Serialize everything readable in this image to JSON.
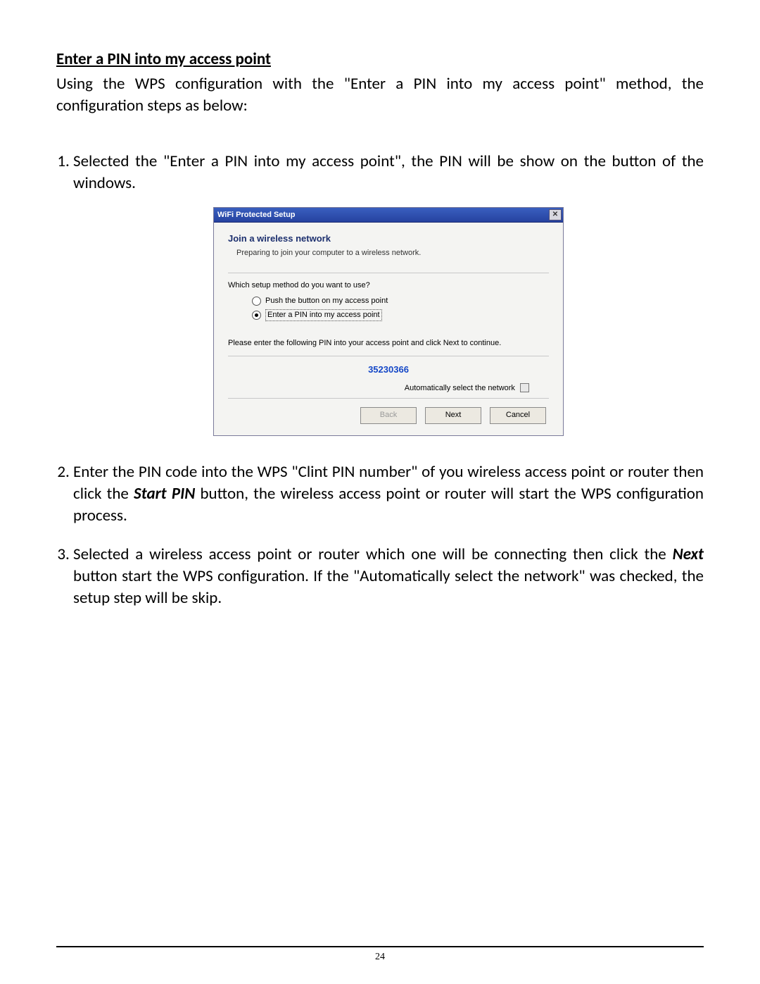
{
  "doc": {
    "section_title": "Enter a PIN into my access point",
    "intro": "Using the WPS configuration with the \"Enter a PIN into my access point\" method, the configuration steps as below:",
    "steps": {
      "s1": "Selected the \"Enter a PIN into my access point\", the PIN will be show on the button of the windows.",
      "s2_a": "Enter the PIN code into the WPS \"Clint PIN number\" of you wireless access point or router then click the ",
      "s2_bold": "Start PIN",
      "s2_b": " button, the wireless access point or router will start the WPS configuration process.",
      "s3_a": "Selected a wireless access point or router which one will be connecting then click the ",
      "s3_bold": "Next",
      "s3_b": " button start the WPS configuration. If the \"Automatically select the network\" was checked, the setup step will be skip."
    },
    "page_number": "24"
  },
  "dialog": {
    "title": "WiFi Protected Setup",
    "heading": "Join a wireless network",
    "subheading": "Preparing to join your computer to a wireless network.",
    "question": "Which setup method do you want to use?",
    "option_push": "Push the button on my access point",
    "option_pin": "Enter a PIN into my access point",
    "pin_instruction": "Please enter the following PIN into your access point and click Next to continue.",
    "pin_value": "35230366",
    "auto_select_label": "Automatically select the network",
    "buttons": {
      "back": "Back",
      "next": "Next",
      "cancel": "Cancel"
    }
  }
}
